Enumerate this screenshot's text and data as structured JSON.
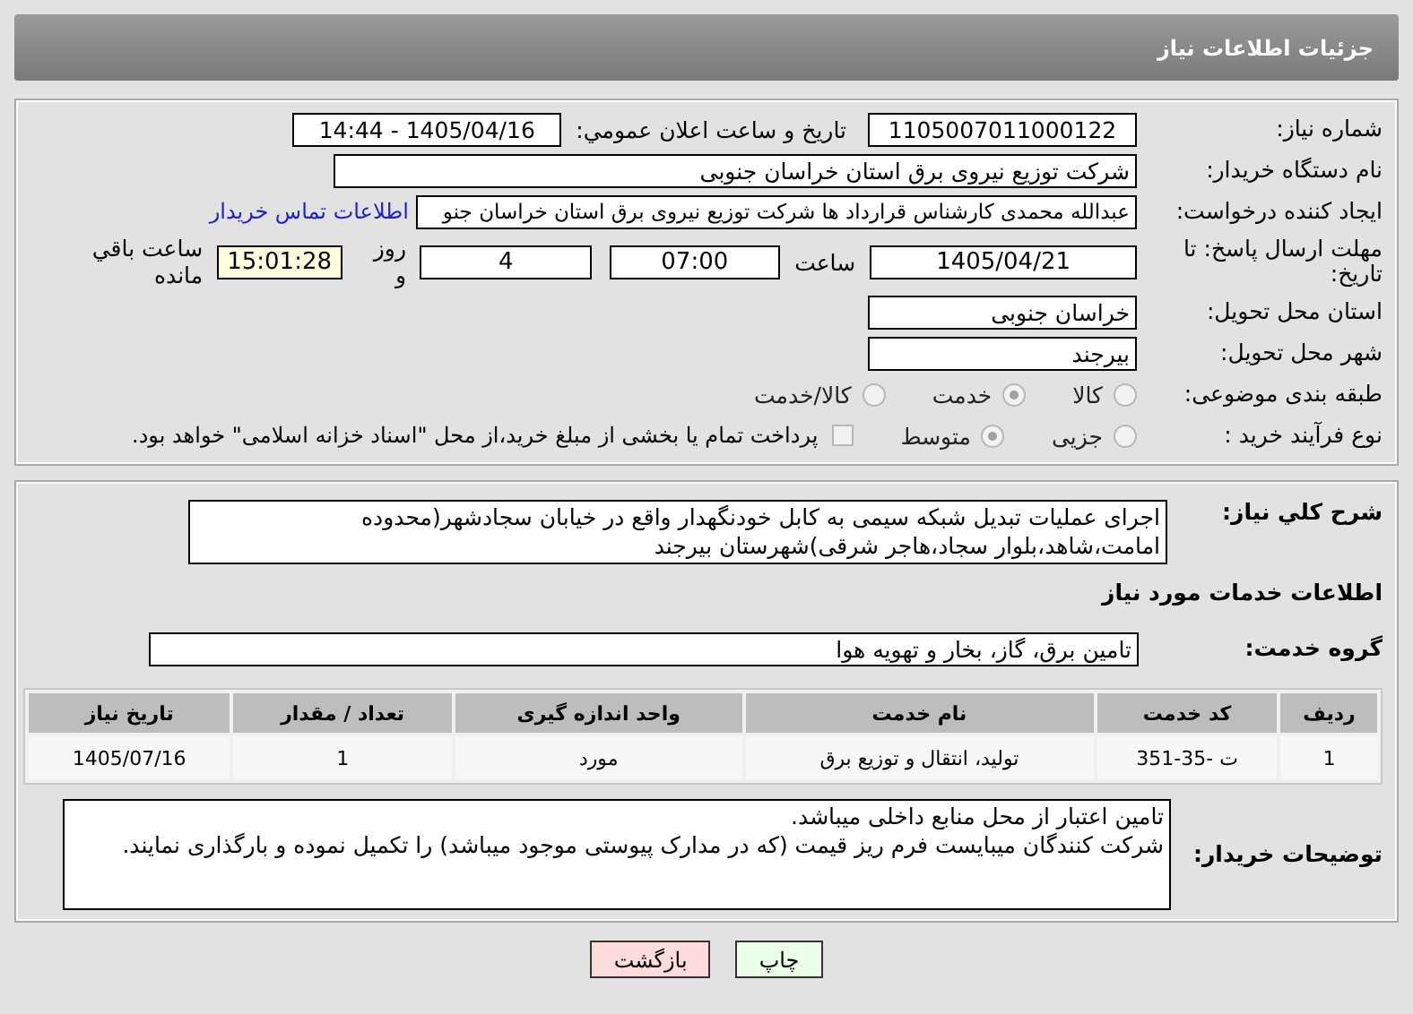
{
  "header": {
    "title": "جزئیات اطلاعات نیاز"
  },
  "need_number": {
    "label": "شماره نیاز:",
    "value": "1105007011000122"
  },
  "announce": {
    "label": "تاریخ و ساعت اعلان عمومي:",
    "value": "1405/04/16 - 14:44"
  },
  "buyer_org": {
    "label": "نام دستگاه خریدار:",
    "value": "شرکت توزیع نیروی برق استان خراسان جنوبی"
  },
  "requester": {
    "label": "ایجاد کننده درخواست:",
    "value": "عبدالله محمدی کارشناس قرارداد ها شرکت توزیع نیروی برق استان خراسان جنو",
    "link": "اطلاعات تماس خریدار"
  },
  "deadline": {
    "label": "مهلت ارسال پاسخ: تا تاریخ:",
    "date": "1405/04/21",
    "time_label": "ساعت",
    "time": "07:00",
    "days": "4",
    "days_label": "روز و",
    "remaining": "15:01:28",
    "remaining_label": "ساعت باقي مانده"
  },
  "province": {
    "label": "استان محل تحویل:",
    "value": "خراسان جنوبی"
  },
  "city": {
    "label": "شهر محل تحویل:",
    "value": "بیرجند"
  },
  "category": {
    "label": "طبقه بندی موضوعی:",
    "options": [
      {
        "label": "کالا",
        "selected": false
      },
      {
        "label": "خدمت",
        "selected": true
      },
      {
        "label": "کالا/خدمت",
        "selected": false
      }
    ]
  },
  "process": {
    "label": "نوع فرآیند خرید :",
    "options": [
      {
        "label": "جزیی",
        "selected": false
      },
      {
        "label": "متوسط",
        "selected": true
      }
    ],
    "payment": {
      "checked": false,
      "text": "پرداخت تمام یا بخشی از مبلغ خرید،از محل \"اسناد خزانه اسلامی\" خواهد بود."
    }
  },
  "description": {
    "label": "شرح کلي نياز:",
    "value": "اجرای عملیات تبدیل شبکه سیمی به کابل خودنگهدار واقع در خیابان سجادشهر(محدوده امامت،شاهد،بلوار سجاد،هاجر شرقی)شهرستان بیرجند"
  },
  "services_heading": "اطلاعات خدمات مورد نیاز",
  "service_group": {
    "label": "گروه خدمت:",
    "value": "تامین برق، گاز، بخار و تهویه هوا"
  },
  "table": {
    "columns": [
      "ردیف",
      "کد خدمت",
      "نام خدمت",
      "واحد اندازه گیری",
      "تعداد / مقدار",
      "تاریخ نیاز"
    ],
    "rows": [
      [
        "1",
        "ت -35-351",
        "تولید، انتقال و توزیع برق",
        "مورد",
        "1",
        "1405/07/16"
      ]
    ]
  },
  "buyer_notes": {
    "label": "توضیحات خریدار:",
    "lines": [
      "تامین اعتبار از محل منابع داخلی میباشد.",
      "شرکت کنندگان میبایست فرم ریز قیمت (که در مدارک پیوستی موجود میباشد) را تکمیل نموده و بارگذاری نمایند."
    ]
  },
  "buttons": [
    {
      "label": "چاپ",
      "kind": "print"
    },
    {
      "label": "بازگشت",
      "kind": "back"
    }
  ]
}
